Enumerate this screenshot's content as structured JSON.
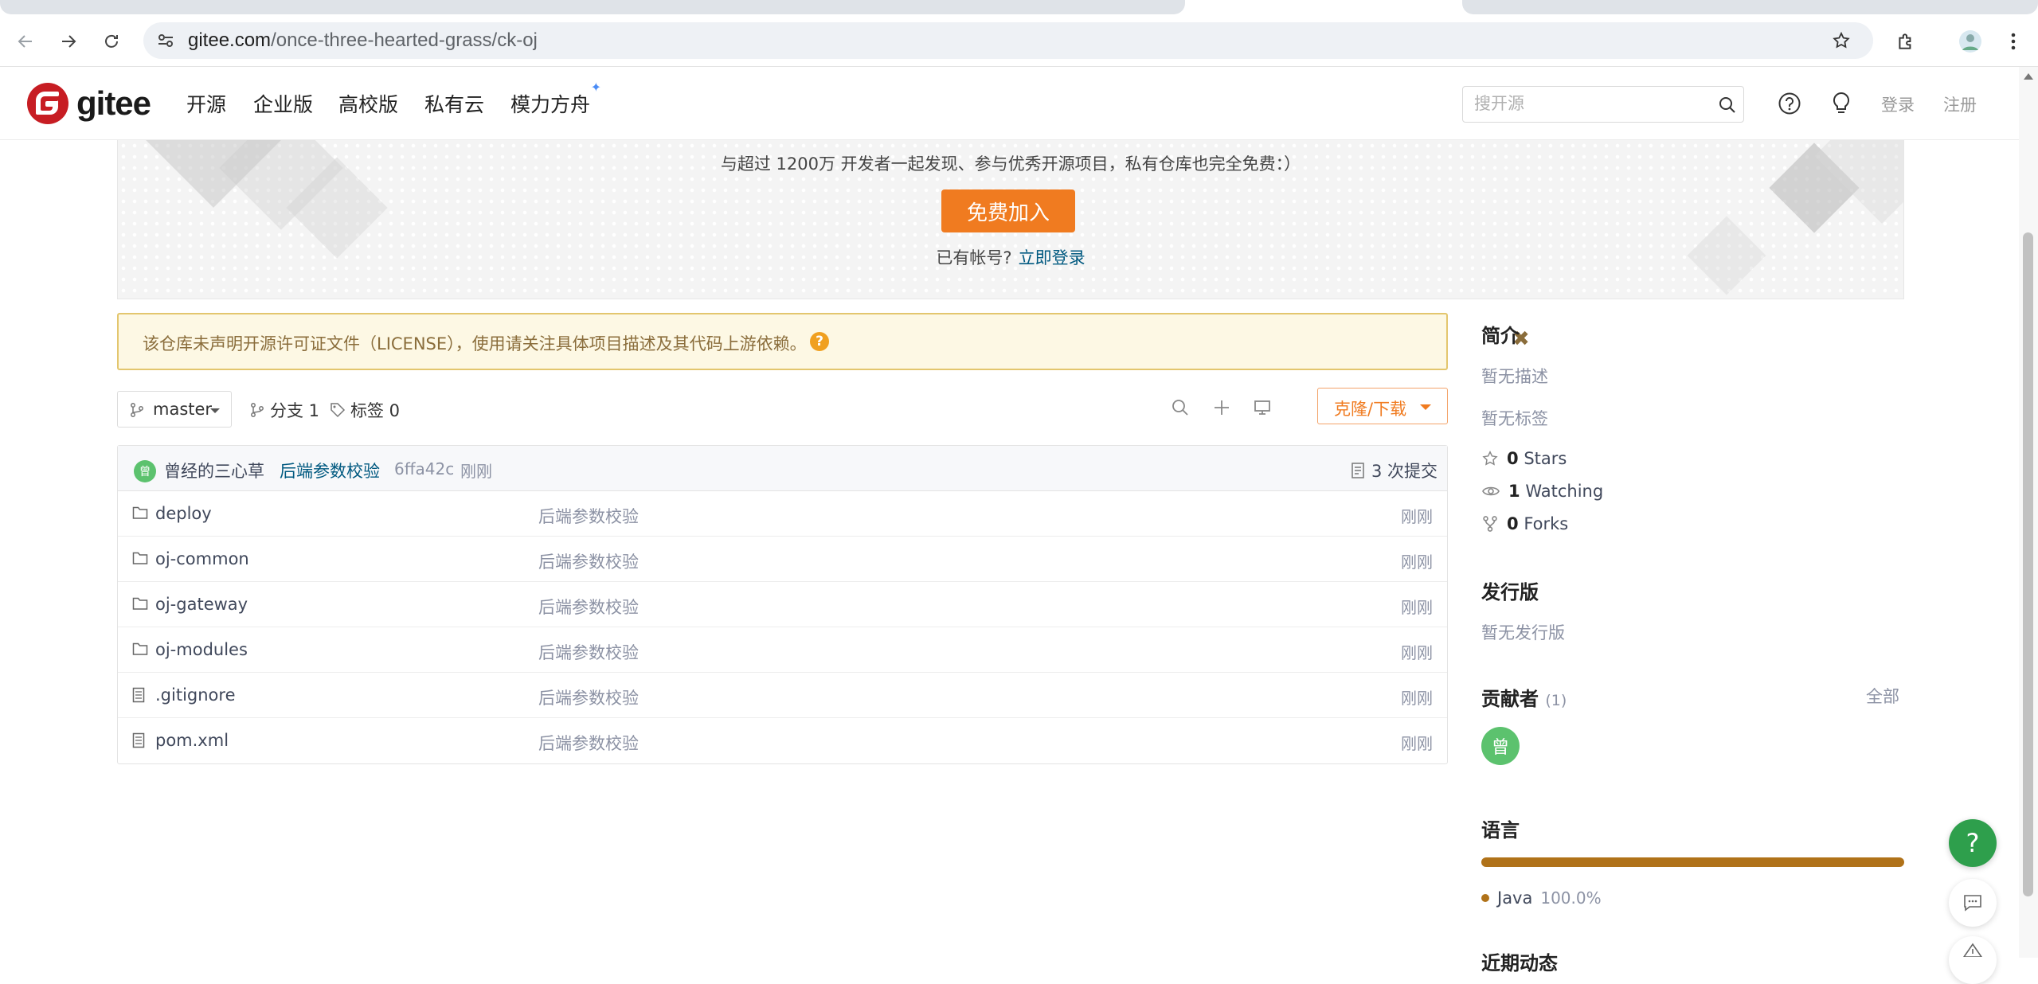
{
  "browser": {
    "url_host": "gitee.com",
    "url_path": "/once-three-hearted-grass/ck-oj"
  },
  "header": {
    "logo_text": "gitee",
    "nav": [
      "开源",
      "企业版",
      "高校版",
      "私有云",
      "模力方舟"
    ],
    "search_placeholder": "搜开源",
    "login": "登录",
    "register": "注册"
  },
  "banner": {
    "tagline": "与超过 1200万 开发者一起发现、参与优秀开源项目，私有仓库也完全免费：）",
    "join_button": "免费加入",
    "have_account": "已有帐号?",
    "login_now": "立即登录"
  },
  "license_warning": {
    "text": "该仓库未声明开源许可证文件（LICENSE），使用请关注具体项目描述及其代码上游依赖。",
    "close": "✖"
  },
  "branch_bar": {
    "branch": "master",
    "branches": "分支 1",
    "tags": "标签 0",
    "clone_button": "克隆/下载"
  },
  "commit": {
    "avatar_char": "曾",
    "author": "曾经的三心草",
    "message": "后端参数校验",
    "sha": "6ffa42c",
    "time": "刚刚",
    "count": "3 次提交"
  },
  "files": [
    {
      "name": "deploy",
      "type": "folder",
      "message": "后端参数校验",
      "time": "刚刚"
    },
    {
      "name": "oj-common",
      "type": "folder",
      "message": "后端参数校验",
      "time": "刚刚"
    },
    {
      "name": "oj-gateway",
      "type": "folder",
      "message": "后端参数校验",
      "time": "刚刚"
    },
    {
      "name": "oj-modules",
      "type": "folder",
      "message": "后端参数校验",
      "time": "刚刚"
    },
    {
      "name": ".gitignore",
      "type": "file",
      "message": "后端参数校验",
      "time": "刚刚"
    },
    {
      "name": "pom.xml",
      "type": "file",
      "message": "后端参数校验",
      "time": "刚刚"
    }
  ],
  "sidebar": {
    "intro_title": "简介",
    "no_description": "暂无描述",
    "no_tags": "暂无标签",
    "stars_count": "0",
    "stars_label": "Stars",
    "watching_count": "1",
    "watching_label": "Watching",
    "forks_count": "0",
    "forks_label": "Forks",
    "releases_title": "发行版",
    "no_releases": "暂无发行版",
    "contributors_title": "贡献者",
    "contributors_count": "(1)",
    "contributors_all": "全部",
    "contributor_avatar_char": "曾",
    "languages_title": "语言",
    "language_name": "Java",
    "language_percent": "100.0%",
    "recent_title": "近期动态"
  },
  "colors": {
    "java": "#b07219",
    "brand_orange": "#f07b20",
    "brand_red": "#c71d23",
    "help_green": "#2e9f4c"
  },
  "help_fab": "?"
}
